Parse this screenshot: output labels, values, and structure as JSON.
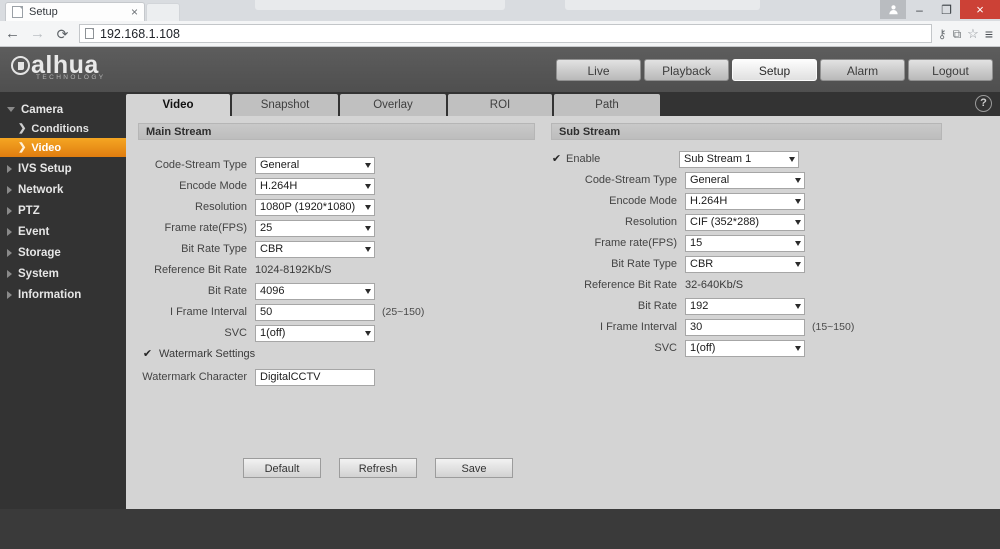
{
  "browser": {
    "tab_title": "Setup",
    "tab_close": "×",
    "back_icon": "←",
    "forward_icon": "→",
    "reload_icon": "⟳",
    "url": "192.168.1.108",
    "window": {
      "minimize": "–",
      "maximize": "❐",
      "close": "×"
    },
    "toolbar_icons": {
      "key": "⚷",
      "extension": "⧉",
      "star": "☆",
      "menu": "≡"
    }
  },
  "brand": {
    "name": "alhua",
    "tagline": "TECHNOLOGY"
  },
  "topnav": {
    "items": [
      {
        "label": "Live",
        "active": false
      },
      {
        "label": "Playback",
        "active": false
      },
      {
        "label": "Setup",
        "active": true
      },
      {
        "label": "Alarm",
        "active": false
      },
      {
        "label": "Logout",
        "active": false
      }
    ]
  },
  "sidebar": {
    "items": [
      {
        "label": "Camera",
        "level": 1,
        "expanded": true,
        "selected": false
      },
      {
        "label": "Conditions",
        "level": 2,
        "selected": false
      },
      {
        "label": "Video",
        "level": 2,
        "selected": true
      },
      {
        "label": "IVS Setup",
        "level": 1,
        "expanded": false,
        "selected": false
      },
      {
        "label": "Network",
        "level": 1,
        "expanded": false,
        "selected": false
      },
      {
        "label": "PTZ",
        "level": 1,
        "expanded": false,
        "selected": false
      },
      {
        "label": "Event",
        "level": 1,
        "expanded": false,
        "selected": false
      },
      {
        "label": "Storage",
        "level": 1,
        "expanded": false,
        "selected": false
      },
      {
        "label": "System",
        "level": 1,
        "expanded": false,
        "selected": false
      },
      {
        "label": "Information",
        "level": 1,
        "expanded": false,
        "selected": false
      }
    ]
  },
  "tabs": {
    "items": [
      {
        "label": "Video",
        "active": true
      },
      {
        "label": "Snapshot",
        "active": false
      },
      {
        "label": "Overlay",
        "active": false
      },
      {
        "label": "ROI",
        "active": false
      },
      {
        "label": "Path",
        "active": false
      }
    ],
    "help_icon": "?"
  },
  "main_stream": {
    "title": "Main Stream",
    "code_stream_type": {
      "label": "Code-Stream Type",
      "value": "General"
    },
    "encode_mode": {
      "label": "Encode Mode",
      "value": "H.264H"
    },
    "resolution": {
      "label": "Resolution",
      "value": "1080P (1920*1080)"
    },
    "frame_rate": {
      "label": "Frame rate(FPS)",
      "value": "25"
    },
    "bit_rate_type": {
      "label": "Bit Rate Type",
      "value": "CBR"
    },
    "reference_bit_rate": {
      "label": "Reference Bit Rate",
      "value": "1024-8192Kb/S"
    },
    "bit_rate": {
      "label": "Bit Rate",
      "value": "4096"
    },
    "i_frame_interval": {
      "label": "I Frame Interval",
      "value": "50",
      "hint": "(25~150)"
    },
    "svc": {
      "label": "SVC",
      "value": "1(off)"
    },
    "watermark_settings": {
      "label": "Watermark Settings",
      "checked": true,
      "check_glyph": "✔"
    },
    "watermark_character": {
      "label": "Watermark Character",
      "value": "DigitalCCTV"
    }
  },
  "sub_stream": {
    "title": "Sub Stream",
    "enable": {
      "label": "Enable",
      "checked": true,
      "check_glyph": "✔",
      "value": "Sub Stream 1"
    },
    "code_stream_type": {
      "label": "Code-Stream Type",
      "value": "General"
    },
    "encode_mode": {
      "label": "Encode Mode",
      "value": "H.264H"
    },
    "resolution": {
      "label": "Resolution",
      "value": "CIF (352*288)"
    },
    "frame_rate": {
      "label": "Frame rate(FPS)",
      "value": "15"
    },
    "bit_rate_type": {
      "label": "Bit Rate Type",
      "value": "CBR"
    },
    "reference_bit_rate": {
      "label": "Reference Bit Rate",
      "value": "32-640Kb/S"
    },
    "bit_rate": {
      "label": "Bit Rate",
      "value": "192"
    },
    "i_frame_interval": {
      "label": "I Frame Interval",
      "value": "30",
      "hint": "(15~150)"
    },
    "svc": {
      "label": "SVC",
      "value": "1(off)"
    }
  },
  "actions": {
    "default_label": "Default",
    "refresh_label": "Refresh",
    "save_label": "Save"
  },
  "colors": {
    "accent_orange": "#e8881a",
    "header_gray": "#565656",
    "sidebar_dark": "#333333",
    "content_gray": "#d4d4d4",
    "browser_close_red": "#cc4136"
  }
}
